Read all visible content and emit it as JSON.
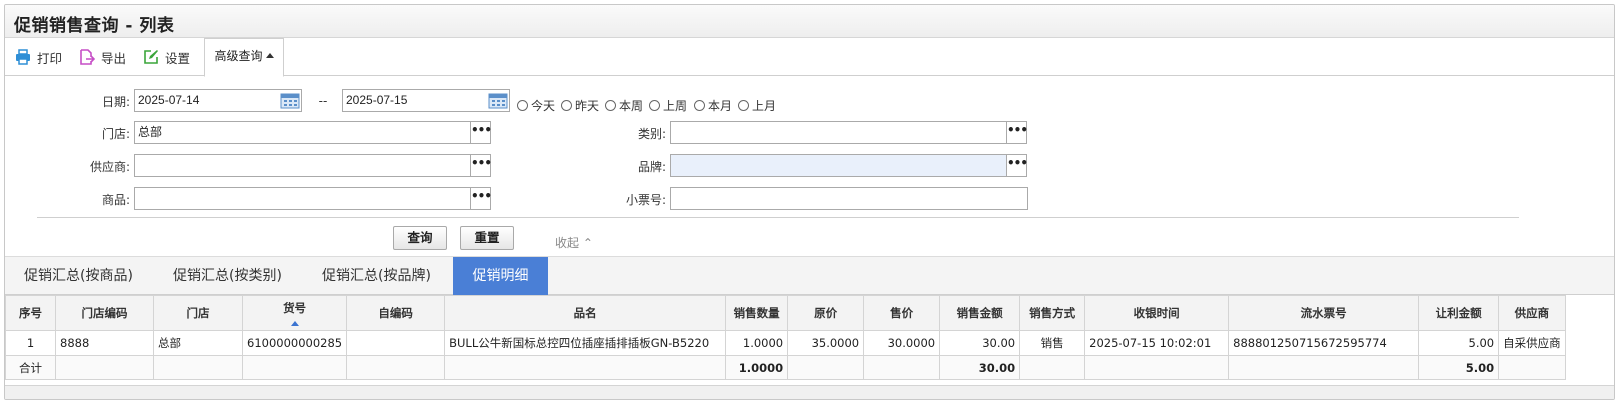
{
  "title": "促销销售查询 - 列表",
  "toolbar": {
    "print": "打印",
    "export": "导出",
    "settings": "设置",
    "advanced": "高级查询"
  },
  "filters": {
    "date_label": "日期:",
    "date_from": "2025-07-14",
    "date_sep": "--",
    "date_to": "2025-07-15",
    "quick_ranges": [
      "今天",
      "昨天",
      "本周",
      "上周",
      "本月",
      "上月"
    ],
    "store_label": "门店:",
    "store_value": "总部",
    "category_label": "类别:",
    "category_value": "",
    "supplier_label": "供应商:",
    "supplier_value": "",
    "brand_label": "品牌:",
    "brand_value": "",
    "product_label": "商品:",
    "product_value": "",
    "receipt_label": "小票号:",
    "receipt_value": "",
    "picker_glyph": "•••"
  },
  "actions": {
    "query": "查询",
    "reset": "重置",
    "collapse": "收起 ⌃"
  },
  "tabs": [
    "促销汇总(按商品)",
    "促销汇总(按类别)",
    "促销汇总(按品牌)",
    "促销明细"
  ],
  "active_tab": 3,
  "table": {
    "columns": [
      "序号",
      "门店编码",
      "门店",
      "货号",
      "自编码",
      "品名",
      "销售数量",
      "原价",
      "售价",
      "销售金额",
      "销售方式",
      "收银时间",
      "流水票号",
      "让利金额",
      "供应商"
    ],
    "rows": [
      [
        "1",
        "8888",
        "总部",
        "6100000000285",
        "",
        "BULL公牛新国标总控四位插座插排插板GN-B5220",
        "1.0000",
        "35.0000",
        "30.0000",
        "30.00",
        "销售",
        "2025-07-15 10:02:01",
        "888801250715672595774",
        "5.00",
        "自采供应商"
      ]
    ],
    "totals": {
      "label": "合计",
      "qty": "1.0000",
      "amount": "30.00",
      "discount": "5.00"
    }
  },
  "colors": {
    "accent": "#4a7fd6",
    "print_icon": "#2f8fd6",
    "export_icon": "#c64fc6",
    "settings_icon": "#3aa53a"
  }
}
